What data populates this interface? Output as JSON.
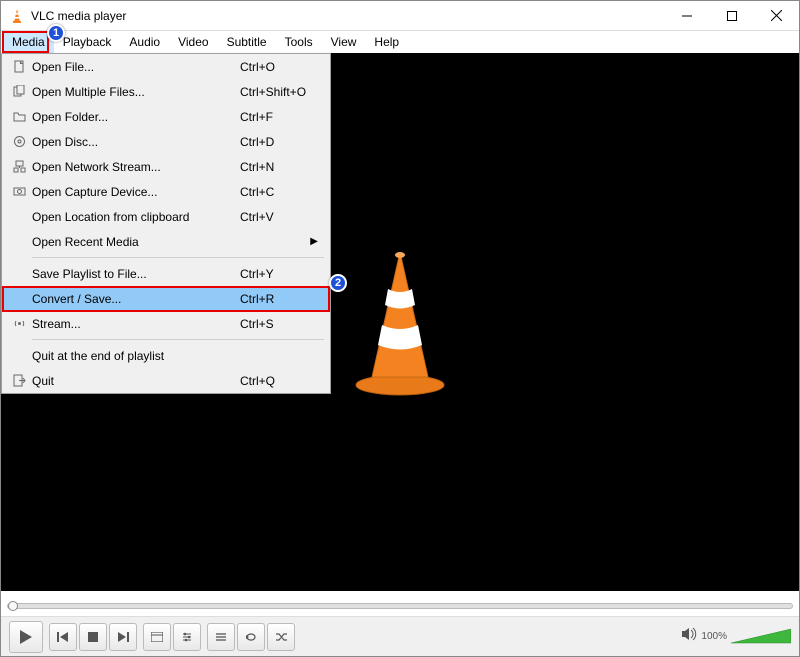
{
  "titlebar": {
    "title": "VLC media player"
  },
  "menubar": {
    "items": [
      "Media",
      "Playback",
      "Audio",
      "Video",
      "Subtitle",
      "Tools",
      "View",
      "Help"
    ],
    "active_index": 0
  },
  "media_menu": {
    "groups": [
      [
        {
          "icon": "file-icon",
          "label": "Open File...",
          "shortcut": "Ctrl+O"
        },
        {
          "icon": "files-icon",
          "label": "Open Multiple Files...",
          "shortcut": "Ctrl+Shift+O"
        },
        {
          "icon": "folder-icon",
          "label": "Open Folder...",
          "shortcut": "Ctrl+F"
        },
        {
          "icon": "disc-icon",
          "label": "Open Disc...",
          "shortcut": "Ctrl+D"
        },
        {
          "icon": "network-icon",
          "label": "Open Network Stream...",
          "shortcut": "Ctrl+N"
        },
        {
          "icon": "capture-icon",
          "label": "Open Capture Device...",
          "shortcut": "Ctrl+C"
        },
        {
          "icon": "",
          "label": "Open Location from clipboard",
          "shortcut": "Ctrl+V"
        },
        {
          "icon": "",
          "label": "Open Recent Media",
          "shortcut": "",
          "submenu": true
        }
      ],
      [
        {
          "icon": "",
          "label": "Save Playlist to File...",
          "shortcut": "Ctrl+Y"
        },
        {
          "icon": "",
          "label": "Convert / Save...",
          "shortcut": "Ctrl+R",
          "highlight": true
        },
        {
          "icon": "stream-icon",
          "label": "Stream...",
          "shortcut": "Ctrl+S"
        }
      ],
      [
        {
          "icon": "",
          "label": "Quit at the end of playlist",
          "shortcut": ""
        },
        {
          "icon": "quit-icon",
          "label": "Quit",
          "shortcut": "Ctrl+Q"
        }
      ]
    ]
  },
  "annotations": {
    "badge1": "1",
    "badge2": "2"
  },
  "volume": {
    "label": "100%"
  }
}
